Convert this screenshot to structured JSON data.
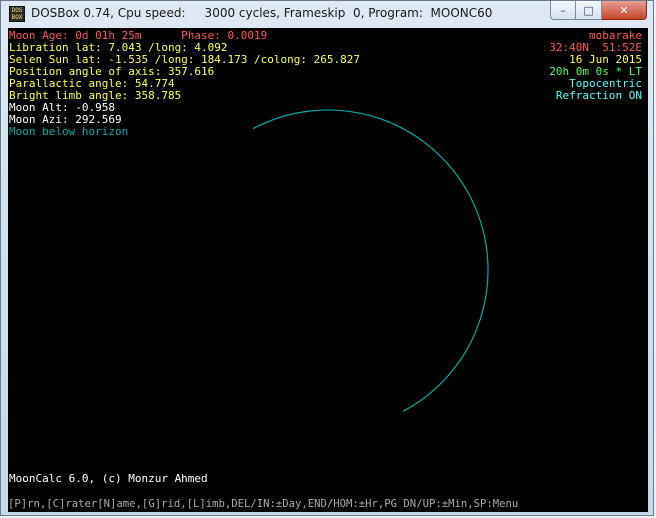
{
  "window": {
    "title": "DOSBox 0.74, Cpu speed:     3000 cycles, Frameskip  0, Program:  MOONC60",
    "icon_text": [
      "DOS",
      "BOX"
    ],
    "controls": {
      "minimize": "–",
      "maximize": "□",
      "close": "✕"
    }
  },
  "info_left": [
    {
      "text": "Moon Age: 0d 01h 25m      Phase: 0.0019",
      "color": "red"
    },
    {
      "text": "Libration lat: 7.043 /long: 4.092",
      "color": "yellow"
    },
    {
      "text": "Selen Sun lat: -1.535 /long: 184.173 /colong: 265.827",
      "color": "yellow"
    },
    {
      "text": "Position angle of axis: 357.616",
      "color": "yellow"
    },
    {
      "text": "Parallactic angle: 54.774",
      "color": "yellow"
    },
    {
      "text": "Bright limb angle: 358.785",
      "color": "yellow"
    },
    {
      "text": "Moon Alt: -0.958",
      "color": "white"
    },
    {
      "text": "Moon Azi: 292.569",
      "color": "white"
    },
    {
      "text": "Moon below horizon",
      "color": "cyan2"
    }
  ],
  "info_right": [
    {
      "text": "mobarake",
      "color": "red"
    },
    {
      "text": "32:40N  51:52E",
      "color": "red"
    },
    {
      "text": "16 Jun 2015",
      "color": "yellow"
    },
    {
      "text": "20h 0m 0s * LT",
      "color": "green"
    },
    {
      "text": "Topocentric",
      "color": "cyan"
    },
    {
      "text": "Refraction ON",
      "color": "cyan"
    }
  ],
  "credit": "MoonCalc 6.0, (c) Monzur Ahmed",
  "footer_keys": "[P]rn,[C]rater[N]ame,[G]rid,[L]imb,DEL/IN:±Day,END/HOM:±Hr,PG DN/UP:±Min,SP:Menu",
  "moon_limb": {
    "bright_limb_angle": 358.785,
    "color": "#00aaaa"
  }
}
